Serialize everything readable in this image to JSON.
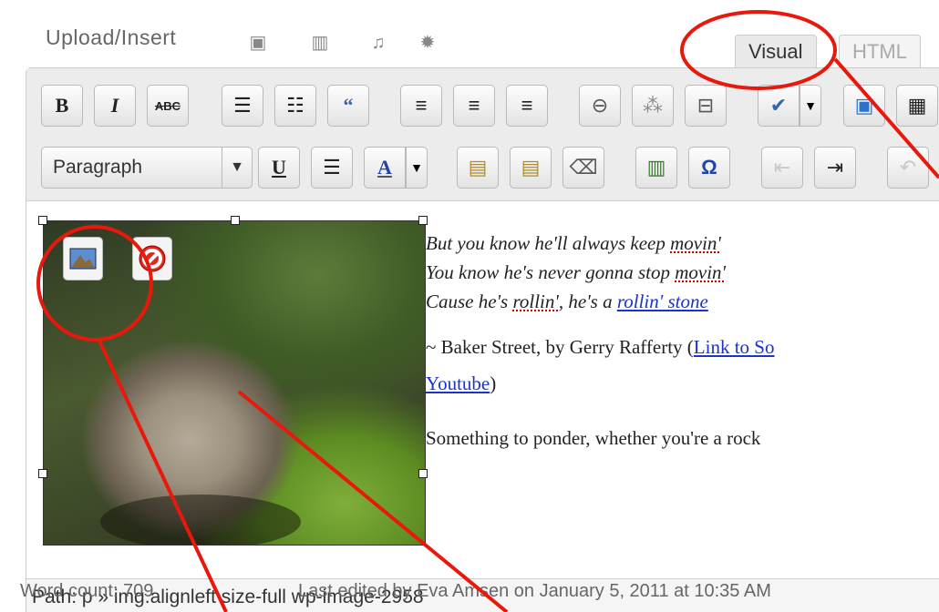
{
  "media": {
    "upload_label": "Upload/Insert",
    "icons": [
      "image-icon",
      "video-icon",
      "audio-icon",
      "media-icon"
    ]
  },
  "tabs": {
    "visual": "Visual",
    "html": "HTML"
  },
  "toolbar": {
    "row1": {
      "bold": "B",
      "italic": "I",
      "strike": "ABC"
    },
    "row2": {
      "format_select": "Paragraph",
      "underline": "U",
      "omega": "Ω"
    }
  },
  "content": {
    "line1": "But you know he'll always keep ",
    "line1_word": "movin'",
    "line2": "You know he's never gonna stop ",
    "line2_word": "movin'",
    "line3_a": "Cause he's ",
    "line3_word": "rollin'",
    "line3_b": ", he's a ",
    "line3_link": "rollin' stone",
    "line4_a": "~ Baker Street, by Gerry Rafferty (",
    "line4_link": "Link to So",
    "line5_link": "Youtube",
    "line5_b": ")",
    "line6": "Something to ponder, whether you're a rock"
  },
  "path_bar": "Path: p » img.alignleft size-full wp-image-2958",
  "word_count": "Word count: 709",
  "last_edited": "Last edited by Eva Amsen on January 5, 2011 at 10:35 AM",
  "colors": {
    "annotation": "#e8180c",
    "link": "#1a33cc",
    "spell": "#cc0000"
  }
}
